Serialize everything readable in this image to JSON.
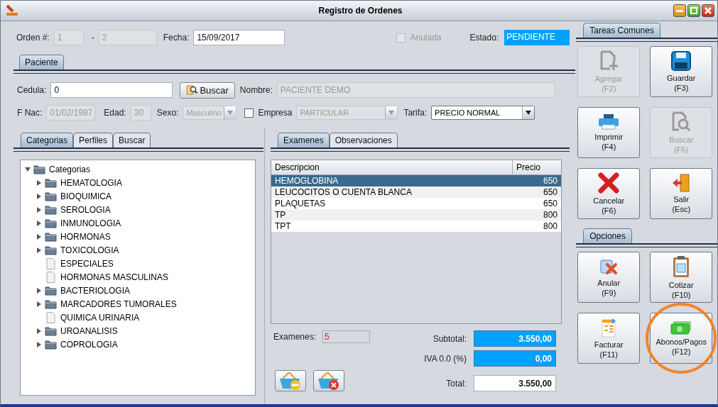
{
  "window": {
    "title": "Registro de Ordenes"
  },
  "header": {
    "order_label": "Orden #:",
    "order_number_1": {
      "value": "1",
      "disabled": true
    },
    "separator": "-",
    "order_number_2": {
      "value": "2",
      "disabled": true
    },
    "date_label": "Fecha:",
    "date": {
      "value": "15/09/2017",
      "disabled": false
    },
    "void_checkbox": {
      "label": "Anulada",
      "checked": false,
      "disabled": true
    },
    "status_label": "Estado:",
    "status": "PENDIENTE"
  },
  "patient_tab": {
    "label": "Paciente",
    "selected": true
  },
  "patient": {
    "id_label": "Cedula:",
    "id": {
      "value": "0",
      "disabled": false
    },
    "search_button": "Buscar",
    "name_label": "Nombre:",
    "name": {
      "value": "PACIENTE DEMO",
      "disabled": true
    },
    "birth_label": "F Nac:",
    "birth_date": {
      "value": "01/02/1987",
      "disabled": true
    },
    "age_label": "Edad:",
    "age": {
      "value": "30",
      "disabled": true
    },
    "sex_label": "Sexo:",
    "sex": {
      "value": "Masculino",
      "disabled": true
    },
    "company_checkbox": {
      "label": "Empresa",
      "checked": false,
      "disabled": false
    },
    "company": {
      "value": "PARTICULAR",
      "disabled": true
    },
    "rate_label": "Tarifa:",
    "rate": {
      "value": "PRECIO NORMAL",
      "disabled": false
    }
  },
  "left_tabs": [
    {
      "label": "Categorias",
      "selected": true
    },
    {
      "label": "Perfiles",
      "selected": false
    },
    {
      "label": "Buscar",
      "selected": false
    }
  ],
  "tree": {
    "label": "Categorias",
    "expanded": true,
    "children": [
      {
        "label": "HEMATOLOGIA",
        "kind": "folder",
        "expanded": false
      },
      {
        "label": "BIOQUIMICA",
        "kind": "folder",
        "expanded": false
      },
      {
        "label": "SEROLOGIA",
        "kind": "folder",
        "expanded": false
      },
      {
        "label": "INMUNOLOGIA",
        "kind": "folder",
        "expanded": false
      },
      {
        "label": "HORMONAS",
        "kind": "folder",
        "expanded": false
      },
      {
        "label": "TOXICOLOGIA",
        "kind": "folder",
        "expanded": false
      },
      {
        "label": "ESPECIALES",
        "kind": "file"
      },
      {
        "label": "HORMONAS MASCULINAS",
        "kind": "file"
      },
      {
        "label": "BACTERIOLOGIA",
        "kind": "folder",
        "expanded": false
      },
      {
        "label": "MARCADORES TUMORALES",
        "kind": "folder",
        "expanded": false
      },
      {
        "label": "QUIMICA URINARIA",
        "kind": "file"
      },
      {
        "label": "UROANALISIS",
        "kind": "folder",
        "expanded": false
      },
      {
        "label": "COPROLOGIA",
        "kind": "folder",
        "expanded": false
      }
    ]
  },
  "right_tabs": [
    {
      "label": "Examenes",
      "selected": true
    },
    {
      "label": "Observaciones",
      "selected": false
    }
  ],
  "table": {
    "columns": [
      "Descripcion",
      "Precio"
    ],
    "rows": [
      {
        "description": "HEMOGLOBINA",
        "price": "650",
        "selected": true
      },
      {
        "description": "LEUCOCITOS O CUENTA BLANCA",
        "price": "650",
        "selected": false
      },
      {
        "description": "PLAQUETAS",
        "price": "650",
        "selected": false
      },
      {
        "description": "TP",
        "price": "800",
        "selected": false
      },
      {
        "description": "TPT",
        "price": "800",
        "selected": false
      }
    ]
  },
  "summary": {
    "count_label": "Examenes:",
    "count": "5",
    "subtotal_label": "Subtotal:",
    "subtotal": "3.550,00",
    "tax_label": "IVA 0.0 (%)",
    "tax": "0,00",
    "total_label": "Total:",
    "total": "3.550,00"
  },
  "basket_buttons": [
    {
      "kind": "remove"
    },
    {
      "kind": "clear"
    }
  ],
  "sections": [
    {
      "title": "Tareas Comunes",
      "buttons": [
        {
          "label": "Agregar",
          "key": "(F2)",
          "kind": "add",
          "disabled": true,
          "highlighted": false
        },
        {
          "label": "Guardar",
          "key": "(F3)",
          "kind": "save",
          "disabled": false,
          "highlighted": false
        },
        {
          "label": "Imprimir",
          "key": "(F4)",
          "kind": "print",
          "disabled": false,
          "highlighted": false
        },
        {
          "label": "Buscar",
          "key": "(F5)",
          "kind": "search",
          "disabled": true,
          "highlighted": false
        },
        {
          "label": "Cancelar",
          "key": "(F6)",
          "kind": "cancel",
          "disabled": false,
          "highlighted": false
        },
        {
          "label": "Salir",
          "key": "(Esc)",
          "kind": "exit",
          "disabled": false,
          "highlighted": false
        }
      ]
    },
    {
      "title": "Opciones",
      "buttons": [
        {
          "label": "Anular",
          "key": "(F9)",
          "kind": "void",
          "disabled": false,
          "highlighted": false
        },
        {
          "label": "Cotizar",
          "key": "(F10)",
          "kind": "quote",
          "disabled": false,
          "highlighted": false
        },
        {
          "label": "Facturar",
          "key": "(F11)",
          "kind": "invoice",
          "disabled": false,
          "highlighted": false
        },
        {
          "label": "Abonos/Pagos",
          "key": "(F12)",
          "kind": "payment",
          "disabled": false,
          "highlighted": true
        }
      ]
    }
  ]
}
